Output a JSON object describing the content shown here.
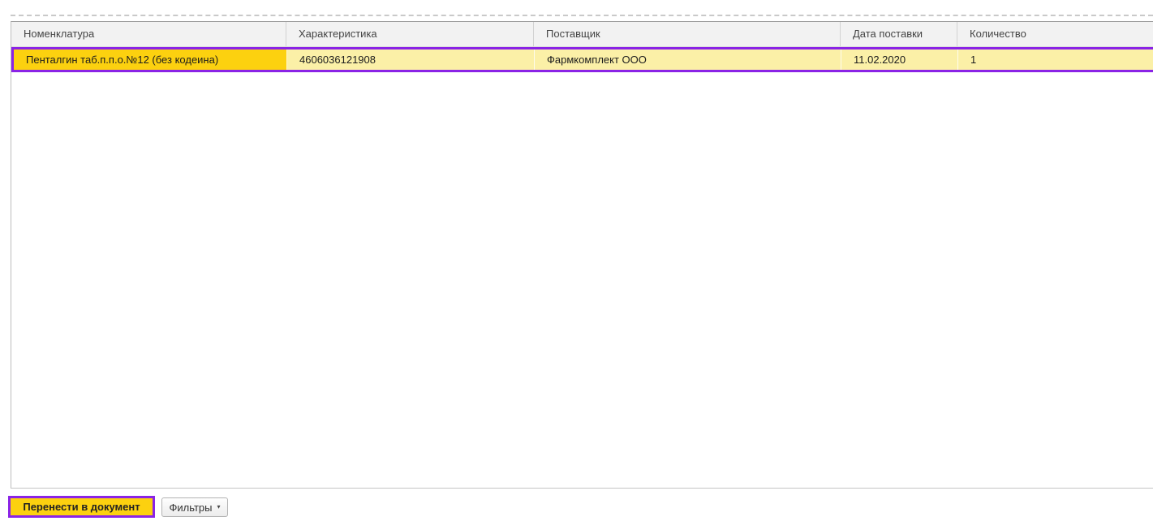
{
  "table": {
    "columns": [
      {
        "label": "Номенклатура"
      },
      {
        "label": "Характеристика"
      },
      {
        "label": "Поставщик"
      },
      {
        "label": "Дата поставки"
      },
      {
        "label": "Количество"
      }
    ],
    "rows": [
      {
        "nomenclature": "Пенталгин таб.п.п.о.№12 (без кодеина)",
        "characteristic": "4606036121908",
        "supplier": "Фармкомплект ООО",
        "delivery_date": "11.02.2020",
        "quantity": "1"
      }
    ]
  },
  "footer": {
    "transfer_button_label": "Перенести в документ",
    "filters_button_label": "Фильтры",
    "filters_dropdown_icon": "▾"
  },
  "colors": {
    "highlight_purple": "#8a23e6",
    "selection_gold": "#fcd10f",
    "selection_pale_yellow": "#fbf0a7",
    "header_bg": "#f2f2f2"
  }
}
